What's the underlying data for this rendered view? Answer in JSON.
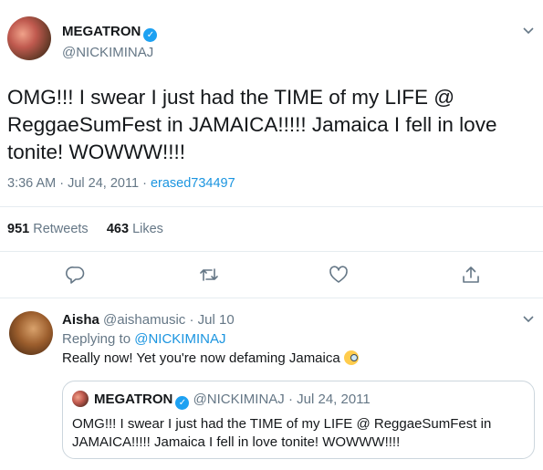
{
  "tweet": {
    "author_name": "MEGATRON",
    "author_handle": "@NICKIMINAJ",
    "text": "OMG!!! I swear I just had the TIME of my LIFE @ ReggaeSumFest in JAMAICA!!!!! Jamaica I fell in love tonite! WOWWW!!!!",
    "time": "3:36 AM",
    "date": "Jul 24, 2011",
    "separator": "·",
    "via": "erased734497",
    "retweets_count": "951",
    "retweets_label": "Retweets",
    "likes_count": "463",
    "likes_label": "Likes"
  },
  "reply": {
    "author_name": "Aisha",
    "author_handle": "@aishamusic",
    "date": "Jul 10",
    "replying_prefix": "Replying to",
    "replying_to": "@NICKIMINAJ",
    "text": "Really now! Yet you're now defaming Jamaica"
  },
  "quote": {
    "author_name": "MEGATRON",
    "author_handle": "@NICKIMINAJ",
    "date": "Jul 24, 2011",
    "text": "OMG!!! I swear I just had the TIME of my LIFE @ ReggaeSumFest in JAMAICA!!!!! Jamaica I fell in love tonite! WOWWW!!!!"
  },
  "icons": {
    "verified": "verified-icon",
    "reply": "reply-icon",
    "retweet": "retweet-icon",
    "like": "like-icon",
    "share": "share-icon",
    "menu": "chevron-down-icon",
    "emoji": "monocle-face-emoji"
  },
  "colors": {
    "link": "#1b95e0",
    "verified": "#1da1f2",
    "muted": "#657786",
    "text": "#14171a"
  }
}
